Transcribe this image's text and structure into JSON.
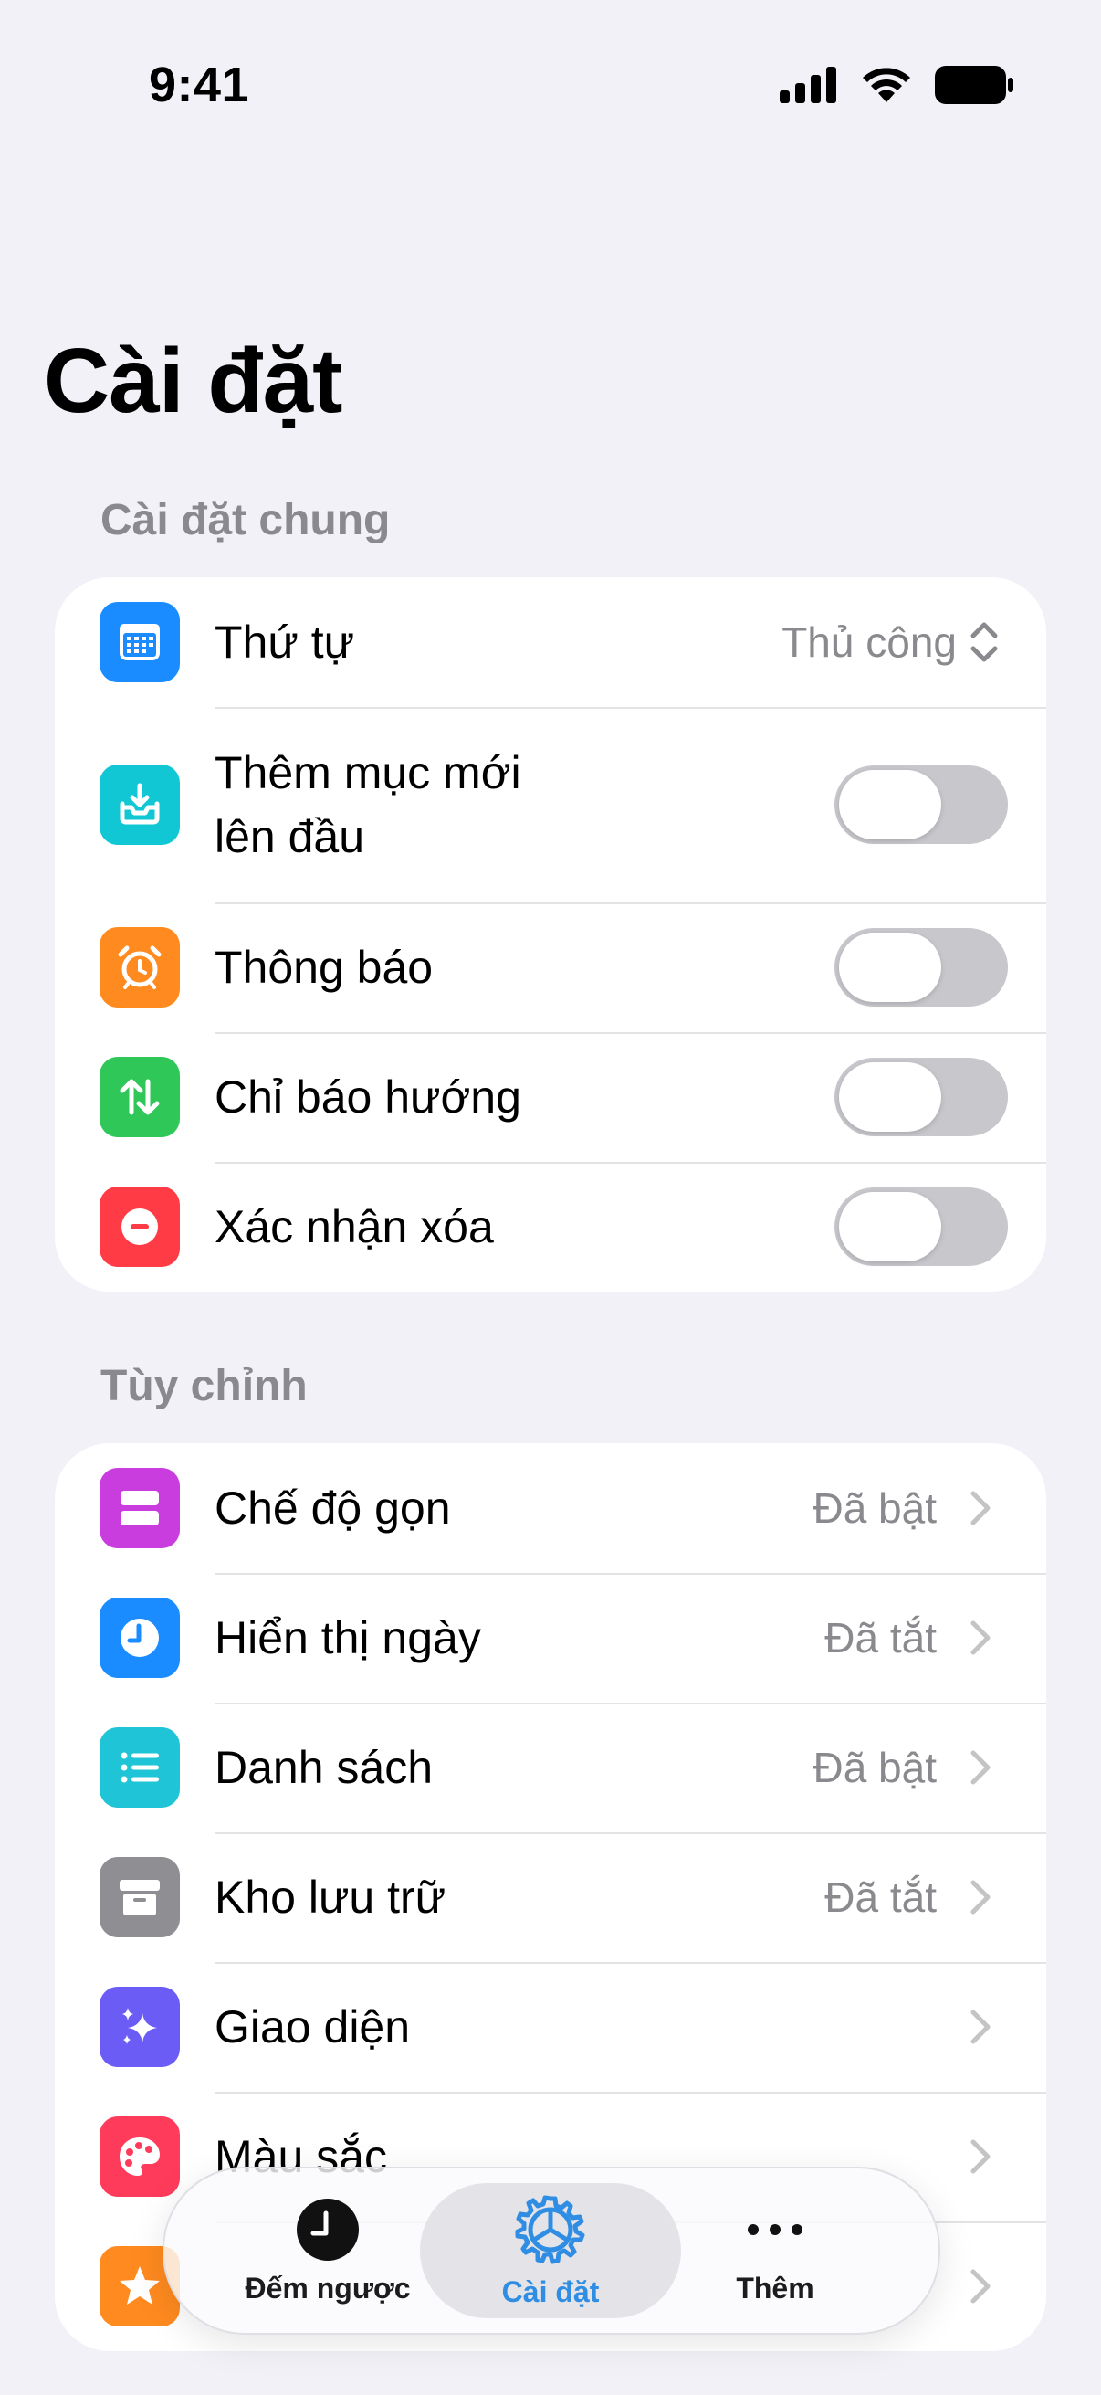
{
  "status_bar": {
    "time": "9:41"
  },
  "page": {
    "title": "Cài đặt"
  },
  "general": {
    "header": "Cài đặt chung",
    "rows": [
      {
        "label": "Thứ tự",
        "value": "Thủ công",
        "icon": "calendar-icon",
        "color": "#1a8cff"
      },
      {
        "label": "Thêm mục mới\nlên đầu",
        "icon": "tray-download-icon",
        "color": "#12c7d4",
        "toggle": false
      },
      {
        "label": "Thông báo",
        "icon": "alarm-clock-icon",
        "color": "#ff8a1f",
        "toggle": false
      },
      {
        "label": "Chỉ báo hướng",
        "icon": "up-down-arrows-icon",
        "color": "#30c759",
        "toggle": false
      },
      {
        "label": "Xác nhận xóa",
        "icon": "minus-circle-icon",
        "color": "#ff3b46",
        "toggle": false
      }
    ]
  },
  "custom": {
    "header": "Tùy chỉnh",
    "rows": [
      {
        "label": "Chế độ gọn",
        "value": "Đã bật",
        "icon": "compact-rows-icon",
        "color": "#c93cde"
      },
      {
        "label": "Hiển thị ngày",
        "value": "Đã tắt",
        "icon": "clock-icon",
        "color": "#1a8cff"
      },
      {
        "label": "Danh sách",
        "value": "Đã bật",
        "icon": "list-icon",
        "color": "#1fc4d6"
      },
      {
        "label": "Kho lưu trữ",
        "value": "Đã tắt",
        "icon": "archive-box-icon",
        "color": "#8e8e93"
      },
      {
        "label": "Giao diện",
        "value": "",
        "icon": "sparkles-icon",
        "color": "#6a5cf5"
      },
      {
        "label": "Màu sắc",
        "value": "",
        "icon": "palette-icon",
        "color": "#ff3b5c"
      },
      {
        "label": "",
        "value": "",
        "icon": "star-icon",
        "color": "#ff8a1f"
      }
    ]
  },
  "tabbar": {
    "tabs": [
      {
        "label": "Đếm ngược",
        "icon": "countdown-clock-icon",
        "active": false
      },
      {
        "label": "Cài đặt",
        "icon": "gear-icon",
        "active": true
      },
      {
        "label": "Thêm",
        "icon": "more-dots-icon",
        "active": false
      }
    ],
    "active_color": "#2f8ee3"
  }
}
